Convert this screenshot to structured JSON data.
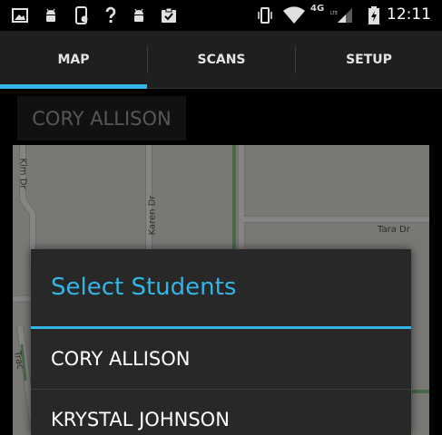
{
  "status_bar": {
    "network_label": "4G",
    "network_sub": "LTE",
    "time": "12:11",
    "icons": [
      "image-icon",
      "android-icon",
      "phone-alert-icon",
      "question-icon",
      "android-icon",
      "clipboard-check-icon",
      "vibrate-icon",
      "wifi-icon",
      "signal-icon",
      "battery-charging-icon"
    ]
  },
  "tabs": [
    {
      "label": "MAP",
      "selected": true
    },
    {
      "label": "SCANS",
      "selected": false
    },
    {
      "label": "SETUP",
      "selected": false
    }
  ],
  "current_student": "CORY ALLISON",
  "map": {
    "streets": [
      "Kim Dr",
      "Karen Dr",
      "Tara Dr",
      "Trac"
    ]
  },
  "dialog": {
    "title": "Select Students",
    "items": [
      "CORY ALLISON",
      "KRYSTAL JOHNSON"
    ]
  },
  "colors": {
    "accent": "#33b5e5",
    "tab_bar": "#1f1f1f",
    "dialog_bg": "#282828",
    "map_bg": "#e8e6e0"
  }
}
